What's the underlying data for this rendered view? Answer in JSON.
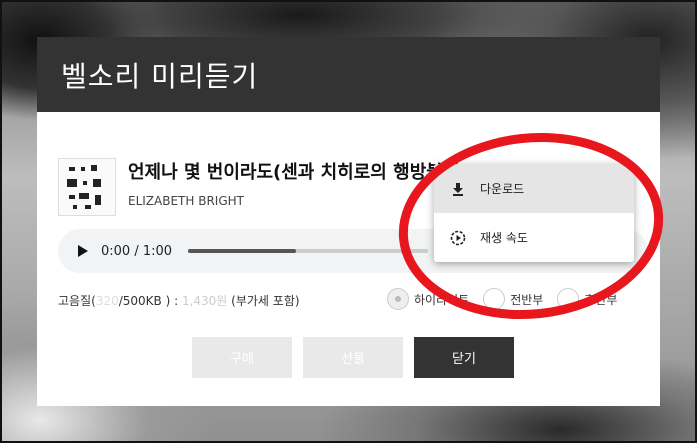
{
  "dialog": {
    "title": "벨소리 미리듣기"
  },
  "song": {
    "title": "언제나 몇 번이라도(센과 치히로의 행방불명)",
    "artist": "ELIZABETH BRIGHT"
  },
  "player": {
    "time": "0:00 / 1:00",
    "progress_fraction": 0.45
  },
  "quality": {
    "label": "고음질(",
    "faded_value": "320",
    "size_suffix": "/500KB ) :",
    "price": "1,430원",
    "tax_note": " (부가세 포함)"
  },
  "segments": [
    {
      "label": "하이라이트",
      "checked": true
    },
    {
      "label": "전반부",
      "checked": false
    },
    {
      "label": "후반부",
      "checked": false
    }
  ],
  "buttons": {
    "buy": "구매",
    "gift": "선물",
    "close": "닫기"
  },
  "menu": {
    "items": [
      {
        "label": "다운로드",
        "icon": "download-icon"
      },
      {
        "label": "재생 속도",
        "icon": "playback-speed-icon"
      }
    ]
  },
  "colors": {
    "header_bg": "#333333",
    "annotation_red": "#e8161d",
    "disabled_button": "#e9e9e9"
  }
}
